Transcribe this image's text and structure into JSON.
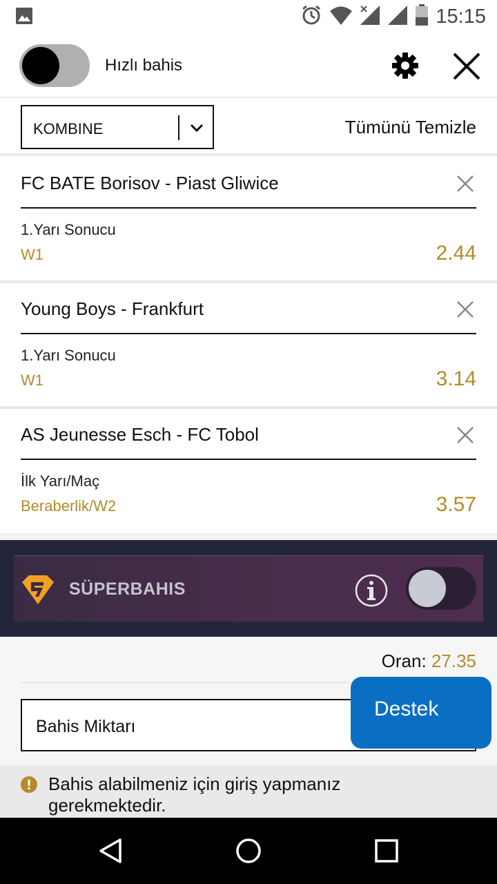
{
  "status_bar": {
    "time": "15:15",
    "icons": [
      "image-icon",
      "alarm-icon",
      "wifi-icon",
      "signal-x-icon",
      "signal-icon",
      "battery-icon"
    ]
  },
  "header": {
    "quick_bet_label": "Hızlı bahis",
    "quick_bet_enabled": false,
    "settings_icon": "gear-icon",
    "close_icon": "close-icon"
  },
  "toolbar": {
    "bet_type_selected": "KOMBINE",
    "clear_all_label": "Tümünü Temizle"
  },
  "bets": [
    {
      "match": "FC BATE Borisov - Piast Gliwice",
      "market": "1.Yarı Sonucu",
      "pick": "W1",
      "odd": "2.44"
    },
    {
      "match": "Young Boys - Frankfurt",
      "market": "1.Yarı Sonucu",
      "pick": "W1",
      "odd": "3.14"
    },
    {
      "match": "AS Jeunesse Esch - FC Tobol",
      "market": "İlk Yarı/Maç",
      "pick": "Beraberlik/W2",
      "odd": "3.57"
    }
  ],
  "superbet": {
    "label": "SÜPERBAHIS",
    "info_icon": "info-icon",
    "enabled": false
  },
  "summary": {
    "odds_label": "Oran:",
    "odds_value": "27.35",
    "amount_placeholder": "Bahis Miktarı"
  },
  "support": {
    "label": "Destek"
  },
  "notice": {
    "text": "Bahis alabilmeniz için giriş yapmanız gerekmektedir."
  },
  "nav": {
    "icons": [
      "back-icon",
      "home-icon",
      "recents-icon"
    ]
  },
  "colors": {
    "accent_gold": "#b48a2a",
    "support_blue": "#0a6fc2",
    "super_dark": "#23263a",
    "super_purple": "#4a2d4c"
  }
}
